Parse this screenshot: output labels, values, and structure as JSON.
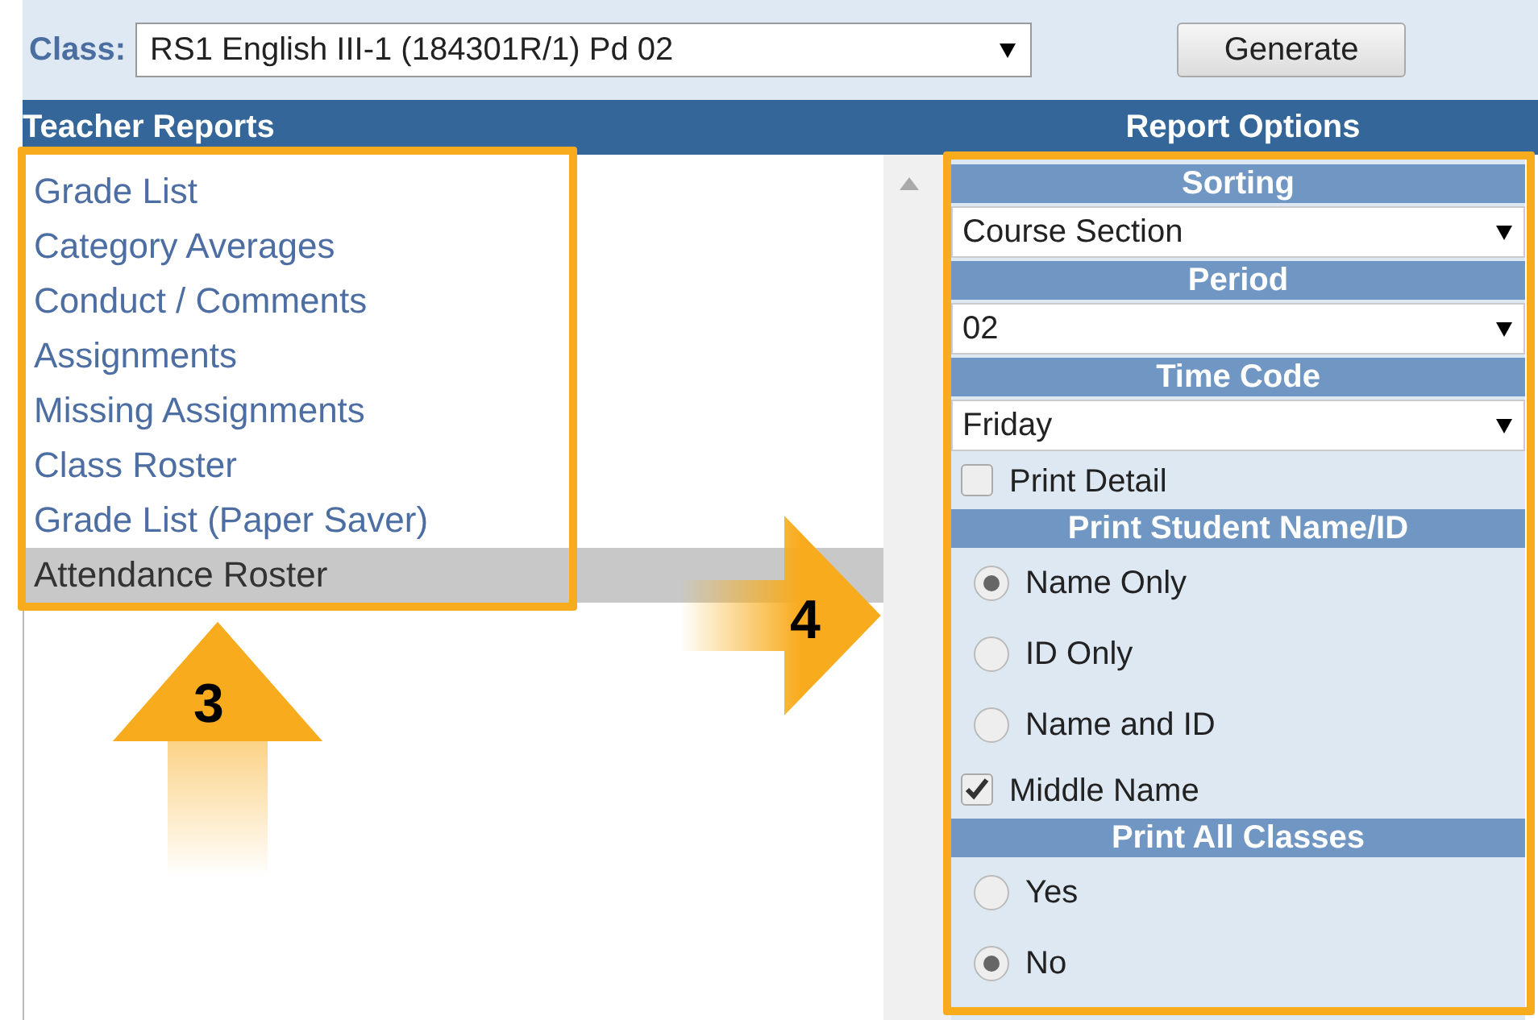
{
  "toolbar": {
    "class_label": "Class:",
    "class_value": "RS1 English III-1 (184301R/1) Pd 02",
    "generate_button": "Generate"
  },
  "left_header": "Teacher Reports",
  "right_header": "Report Options",
  "reports": [
    {
      "label": "Grade List",
      "selected": false
    },
    {
      "label": "Category Averages",
      "selected": false
    },
    {
      "label": "Conduct / Comments",
      "selected": false
    },
    {
      "label": "Assignments",
      "selected": false
    },
    {
      "label": "Missing Assignments",
      "selected": false
    },
    {
      "label": "Class Roster",
      "selected": false
    },
    {
      "label": "Grade List (Paper Saver)",
      "selected": false
    },
    {
      "label": "Attendance Roster",
      "selected": true
    }
  ],
  "options": [
    {
      "kind": "header",
      "label": "Sorting"
    },
    {
      "kind": "select",
      "value": "Course Section"
    },
    {
      "kind": "header",
      "label": "Period"
    },
    {
      "kind": "select",
      "value": "02"
    },
    {
      "kind": "header",
      "label": "Time Code"
    },
    {
      "kind": "select",
      "value": "Friday"
    },
    {
      "kind": "checkbox",
      "label": "Print Detail",
      "checked": false
    },
    {
      "kind": "header",
      "label": "Print Student Name/ID"
    },
    {
      "kind": "radio",
      "label": "Name Only",
      "selected": true
    },
    {
      "kind": "radio",
      "label": "ID Only",
      "selected": false
    },
    {
      "kind": "radio",
      "label": "Name and ID",
      "selected": false
    },
    {
      "kind": "checkbox",
      "label": "Middle Name",
      "checked": true
    },
    {
      "kind": "header",
      "label": "Print All Classes"
    },
    {
      "kind": "radio",
      "label": "Yes",
      "selected": false
    },
    {
      "kind": "radio",
      "label": "No",
      "selected": true
    }
  ],
  "annotations": [
    {
      "label": "3",
      "kind": "up"
    },
    {
      "label": "4",
      "kind": "right"
    }
  ]
}
